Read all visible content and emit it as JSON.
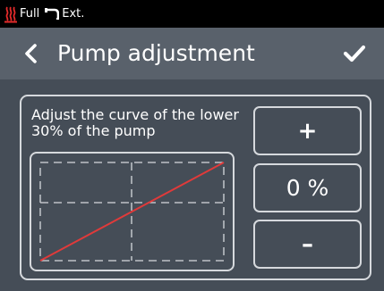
{
  "status_bar": {
    "icons": [
      "heating-icon",
      "faucet-icon"
    ],
    "mode_label": "Full",
    "water_label": "Ext."
  },
  "header": {
    "title": "Pump adjustment",
    "back_icon": "chevron-left-icon",
    "confirm_icon": "checkmark-icon"
  },
  "instruction": "Adjust the curve of the lower 30% of the pump",
  "controls": {
    "increase_symbol": "+",
    "value": "0 %",
    "decrease_symbol": "–"
  },
  "curve": {
    "adjustment_percent": 0,
    "shape": "linear",
    "line_color": "#e03a3a"
  },
  "colors": {
    "background": "#454d57",
    "header": "#59616b",
    "status_bar": "#000000",
    "outline": "#d6d9dd",
    "heating_icon": "#e62b2b"
  }
}
